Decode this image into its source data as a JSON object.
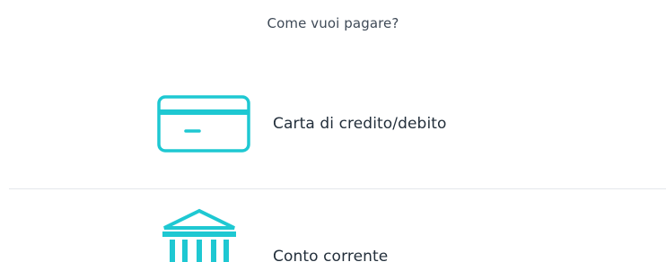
{
  "payment": {
    "question": "Come vuoi pagare?",
    "options": [
      {
        "label": "Carta di credito/debito",
        "icon": "credit-card-icon"
      },
      {
        "label": "Conto corrente",
        "icon": "bank-icon"
      }
    ]
  },
  "colors": {
    "accent": "#1ec8d2",
    "text": "#232f3b",
    "muted_text": "#3f4a57",
    "divider": "#e4e7eb"
  }
}
